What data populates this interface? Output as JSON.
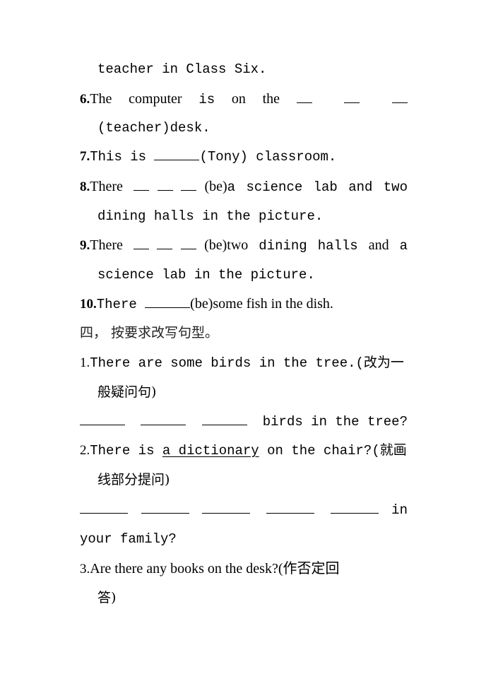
{
  "document": {
    "items": {
      "item5_cont": "teacher in Class Six.",
      "item6": {
        "number": "6.",
        "words": [
          "The",
          "computer",
          "is",
          "on",
          "the"
        ],
        "cont": "(teacher)desk."
      },
      "item7": {
        "number": "7.",
        "before": "This is",
        "after": "(Tony) classroom."
      },
      "item8": {
        "number": "8.",
        "before": "There",
        "hint": "(be)",
        "after_words": [
          "a",
          "science",
          "lab",
          "and",
          "two"
        ],
        "cont": "dining halls in the picture."
      },
      "item9": {
        "number": "9.",
        "before": "There",
        "hint": "(be)",
        "after_words": [
          "two",
          "dining",
          "halls",
          "and",
          "a"
        ],
        "cont": "science lab in the picture."
      },
      "item10": {
        "number": "10.",
        "before": "There",
        "hint": "(be)",
        "after": "some fish in the dish."
      }
    },
    "section4": {
      "heading": "四， 按要求改写句型。",
      "q1": {
        "number": "1.",
        "text": "There are some birds in the tree.(改为一",
        "cont": "般疑问句)",
        "answer_after": "birds in the tree?"
      },
      "q2": {
        "number": "2.",
        "before": "There is",
        "underlined": "a dictionary",
        "after": "on the chair?(就画",
        "cont": "线部分提问)",
        "answer_after": "in",
        "answer_cont": "your family?"
      },
      "q3": {
        "number": "3.",
        "text": "Are there any books on the desk?(作否定回",
        "cont": "答)"
      }
    }
  }
}
